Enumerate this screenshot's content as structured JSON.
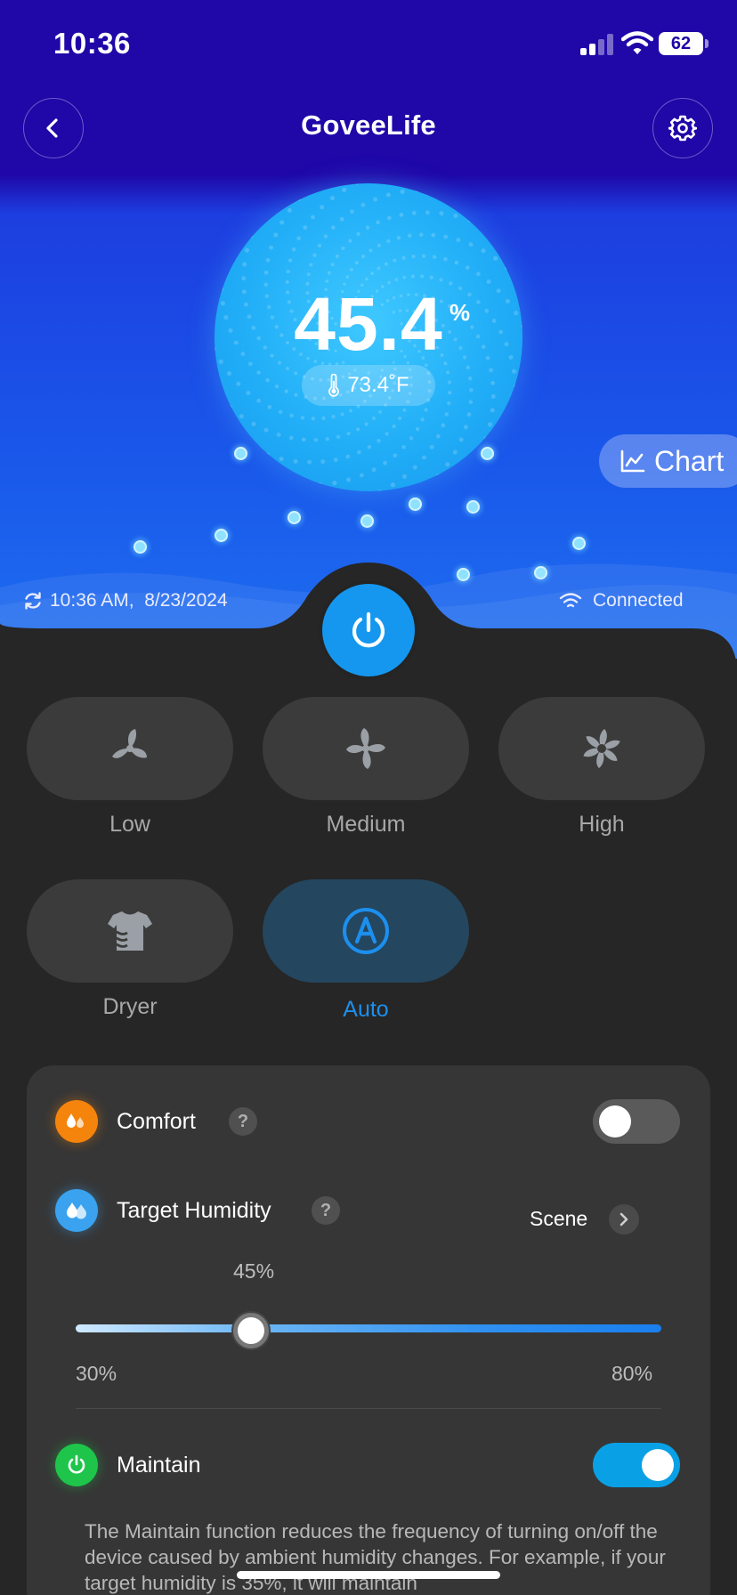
{
  "status_bar": {
    "time": "10:36",
    "battery": "62"
  },
  "header": {
    "title": "GoveeLife",
    "back_icon": "chevron-left-icon",
    "settings_icon": "gear-icon"
  },
  "hero": {
    "humidity": "45.4",
    "humidity_unit": "%",
    "temperature": "73.4˚F",
    "chart_button": "Chart",
    "sync_time": "10:36 AM,  8/23/2024",
    "connection": "Connected",
    "colors": {
      "bubble": "#21aef7",
      "header_bg": "#1f07a8",
      "accent": "#1597ef"
    }
  },
  "modes": [
    {
      "label": "Low",
      "icon": "fan-low-icon",
      "active": false
    },
    {
      "label": "Medium",
      "icon": "fan-medium-icon",
      "active": false
    },
    {
      "label": "High",
      "icon": "fan-high-icon",
      "active": false
    },
    {
      "label": "Dryer",
      "icon": "shirt-dryer-icon",
      "active": false
    },
    {
      "label": "Auto",
      "icon": "auto-a-icon",
      "active": true
    }
  ],
  "settings": {
    "comfort": {
      "label": "Comfort",
      "help": "?",
      "on": false
    },
    "target_humidity": {
      "label": "Target Humidity",
      "help": "?",
      "scene_label": "Scene",
      "value_text": "45%",
      "value": 45,
      "min_label": "30%",
      "max_label": "80%",
      "min": 30,
      "max": 80
    },
    "maintain": {
      "label": "Maintain",
      "on": true,
      "description": "The Maintain function reduces the frequency of turning on/off the device caused by ambient humidity changes. For example, if your target humidity is 35%, it will maintain"
    }
  }
}
